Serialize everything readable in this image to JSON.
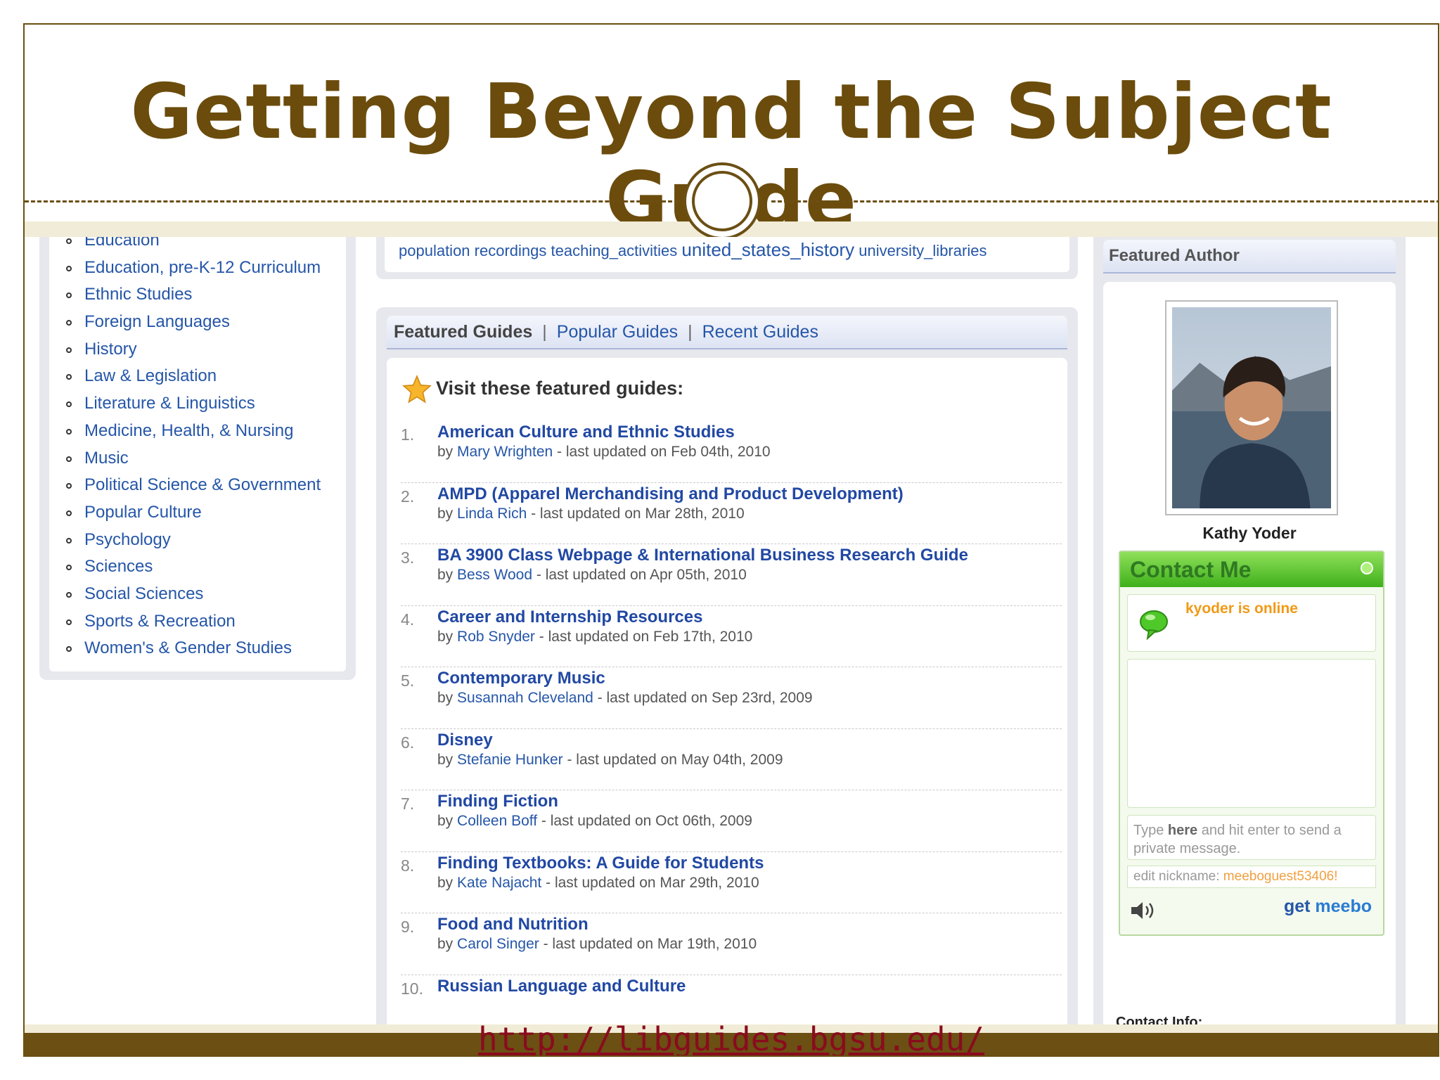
{
  "slide": {
    "title": "Getting Beyond the Subject Guide",
    "footer_link": "http://libguides.bgsu.edu/"
  },
  "subjects": [
    "Education",
    "Education, pre-K-12 Curriculum",
    "Ethnic Studies",
    "Foreign Languages",
    "History",
    "Law & Legislation",
    "Literature & Linguistics",
    "Medicine, Health, & Nursing",
    "Music",
    "Political Science & Government",
    "Popular Culture",
    "Psychology",
    "Sciences",
    "Social Sciences",
    "Sports & Recreation",
    "Women's & Gender Studies"
  ],
  "tags": [
    "population",
    "recordings",
    "teaching_activities",
    "united_states_history",
    "university_libraries"
  ],
  "guides_tabs": {
    "featured": "Featured Guides",
    "separator": "|",
    "popular": "Popular Guides",
    "recent": "Recent Guides"
  },
  "featured_heading": "Visit these featured guides:",
  "guides": [
    {
      "num": "1.",
      "title": "American Culture and Ethnic Studies",
      "by": "by",
      "author": "Mary Wrighten",
      "updated": "- last updated on Feb 04th, 2010"
    },
    {
      "num": "2.",
      "title": "AMPD (Apparel Merchandising and Product Development)",
      "by": "by",
      "author": "Linda Rich",
      "updated": "- last updated on Mar 28th, 2010"
    },
    {
      "num": "3.",
      "title": "BA 3900 Class Webpage & International Business Research Guide",
      "by": "by",
      "author": "Bess Wood",
      "updated": "- last updated on Apr 05th, 2010"
    },
    {
      "num": "4.",
      "title": "Career and Internship Resources",
      "by": "by",
      "author": "Rob Snyder",
      "updated": "- last updated on Feb 17th, 2010"
    },
    {
      "num": "5.",
      "title": "Contemporary Music",
      "by": "by",
      "author": "Susannah Cleveland",
      "updated": "- last updated on Sep 23rd, 2009"
    },
    {
      "num": "6.",
      "title": "Disney",
      "by": "by",
      "author": "Stefanie Hunker",
      "updated": "- last updated on May 04th, 2009"
    },
    {
      "num": "7.",
      "title": "Finding Fiction",
      "by": "by",
      "author": "Colleen Boff",
      "updated": "- last updated on Oct 06th, 2009"
    },
    {
      "num": "8.",
      "title": "Finding Textbooks: A Guide for Students",
      "by": "by",
      "author": "Kate Najacht",
      "updated": "- last updated on Mar 29th, 2010"
    },
    {
      "num": "9.",
      "title": "Food and Nutrition",
      "by": "by",
      "author": "Carol Singer",
      "updated": "- last updated on Mar 19th, 2010"
    },
    {
      "num": "10.",
      "title": "Russian Language and Culture",
      "by": "",
      "author": "",
      "updated": ""
    }
  ],
  "featured_author": {
    "header": "Featured Author",
    "name": "Kathy Yoder"
  },
  "meebo": {
    "header": "Contact Me",
    "status": "kyoder is online",
    "input_pre": "Type ",
    "input_bold": "here",
    "input_post": " and hit enter to send a private message.",
    "nick_label": "edit nickname: ",
    "nick_value": "meeboguest53406!",
    "get": "get",
    "brand": "meebo"
  },
  "contact_info": "Contact Info:",
  "colors": {
    "title_brown": "#6b4c0c",
    "frame_brown": "#6b4f13",
    "link_blue": "#2556a8",
    "meebo_green": "#3fb01a",
    "footer_link": "#8a0b1e"
  }
}
